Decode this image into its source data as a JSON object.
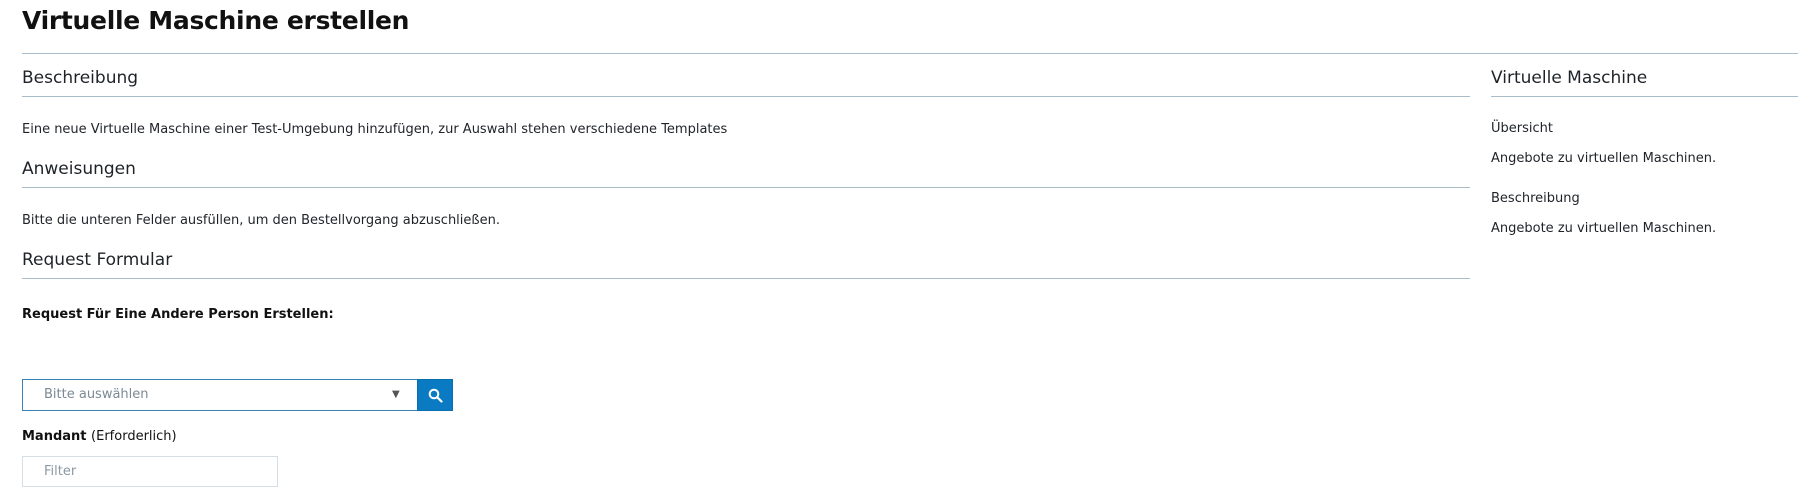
{
  "page": {
    "title": "Virtuelle Maschine erstellen"
  },
  "main": {
    "sections": [
      {
        "heading": "Beschreibung",
        "text": "Eine neue Virtuelle Maschine einer Test-Umgebung hinzufügen, zur Auswahl stehen verschiedene Templates"
      },
      {
        "heading": "Anweisungen",
        "text": "Bitte die unteren Felder ausfüllen, um den Bestellvorgang abzuschließen."
      },
      {
        "heading": "Request Formular"
      }
    ],
    "form": {
      "requested_for": {
        "label": "Request Für Eine Andere Person Erstellen:",
        "placeholder": "Bitte auswählen"
      },
      "mandant": {
        "label": "Mandant",
        "required_text": "(Erforderlich)",
        "placeholder": "Filter"
      }
    }
  },
  "aside": {
    "heading": "Virtuelle Maschine",
    "items": [
      {
        "title": "Übersicht",
        "description": "Angebote zu virtuellen Maschinen."
      },
      {
        "title": "Beschreibung",
        "description": "Angebote zu virtuellen Maschinen."
      }
    ]
  },
  "icons": {
    "search": "search-icon",
    "dropdown": "caret-down-icon"
  },
  "colors": {
    "accent": "#0a7ac2",
    "rule": "#a9bcc9"
  }
}
